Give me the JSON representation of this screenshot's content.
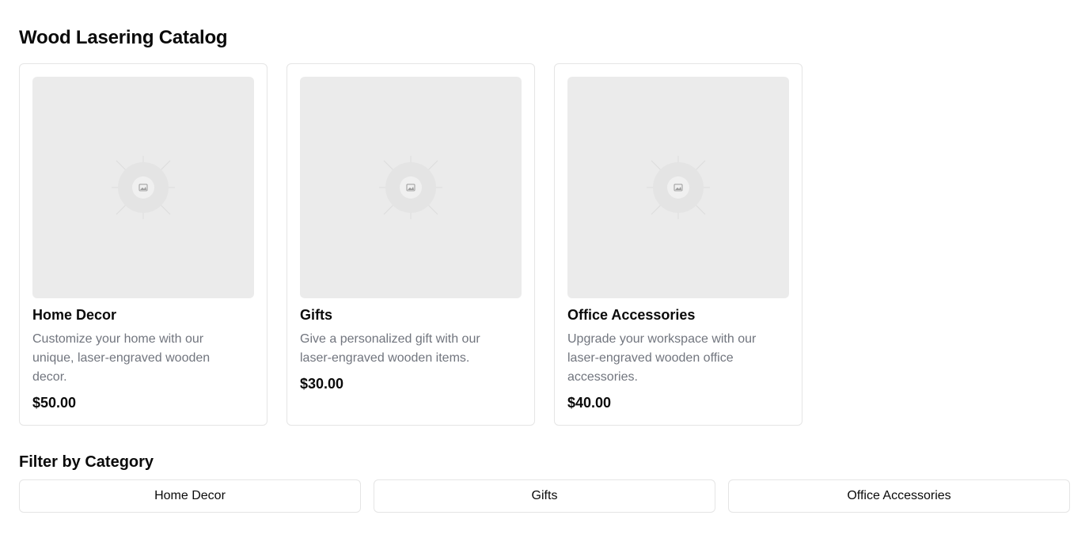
{
  "page": {
    "title": "Wood Lasering Catalog"
  },
  "products": [
    {
      "title": "Home Decor",
      "description": "Customize your home with our unique, laser-engraved wooden decor.",
      "price": "$50.00",
      "image_icon": "image-placeholder-icon"
    },
    {
      "title": "Gifts",
      "description": "Give a personalized gift with our laser-engraved wooden items.",
      "price": "$30.00",
      "image_icon": "image-placeholder-icon"
    },
    {
      "title": "Office Accessories",
      "description": "Upgrade your workspace with our laser-engraved wooden office accessories.",
      "price": "$40.00",
      "image_icon": "image-placeholder-icon"
    }
  ],
  "filter": {
    "title": "Filter by Category",
    "buttons": [
      "Home Decor",
      "Gifts",
      "Office Accessories"
    ]
  },
  "colors": {
    "placeholder_bg": "#ebebeb",
    "border": "#e5e5e5",
    "muted_text": "#71757e"
  }
}
